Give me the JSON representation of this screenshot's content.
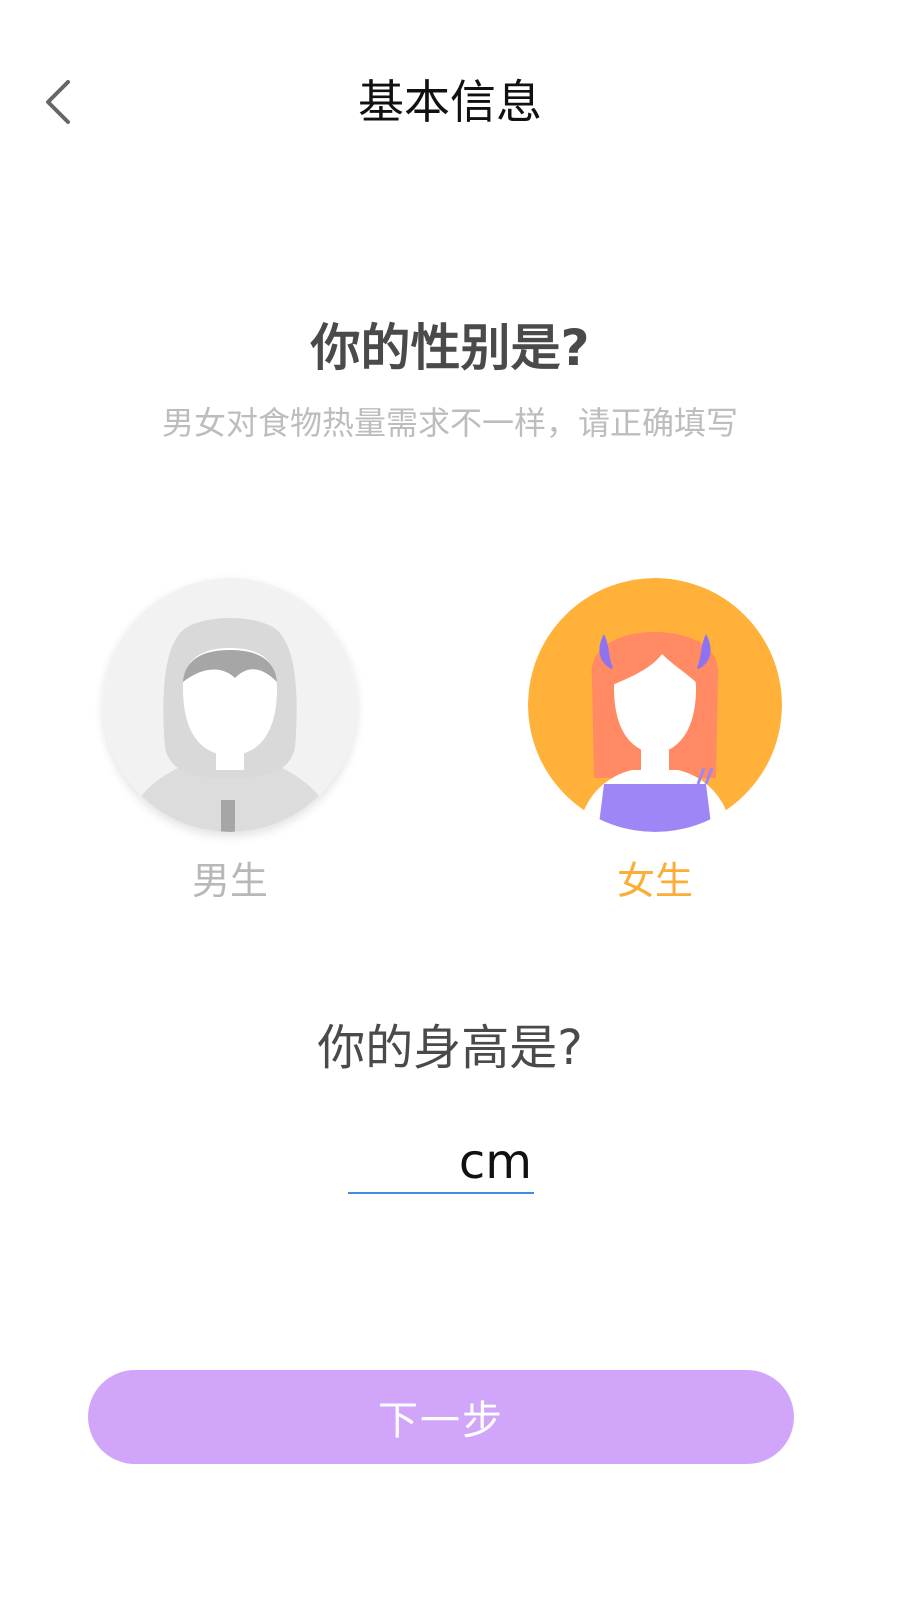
{
  "header": {
    "back_icon": "chevron-left-icon",
    "title": "基本信息"
  },
  "gender": {
    "title": "你的性别是?",
    "subtitle": "男女对食物热量需求不一样，请正确填写",
    "selected": "female",
    "options": [
      {
        "id": "male",
        "label": "男生",
        "avatar_icon": "male-avatar-icon"
      },
      {
        "id": "female",
        "label": "女生",
        "avatar_icon": "female-avatar-icon"
      }
    ],
    "colors": {
      "selected_label": "#fbad36",
      "unselected_label": "#b8b8b8",
      "female_avatar_bg": "#ffb13a",
      "male_avatar_bg": "#f2f2f2"
    }
  },
  "height": {
    "title": "你的身高是?",
    "value": "",
    "placeholder": "",
    "unit": "cm",
    "underline_color": "#3a8ee6"
  },
  "footer": {
    "next_label": "下一步",
    "button_color": "#d1a6fa"
  }
}
